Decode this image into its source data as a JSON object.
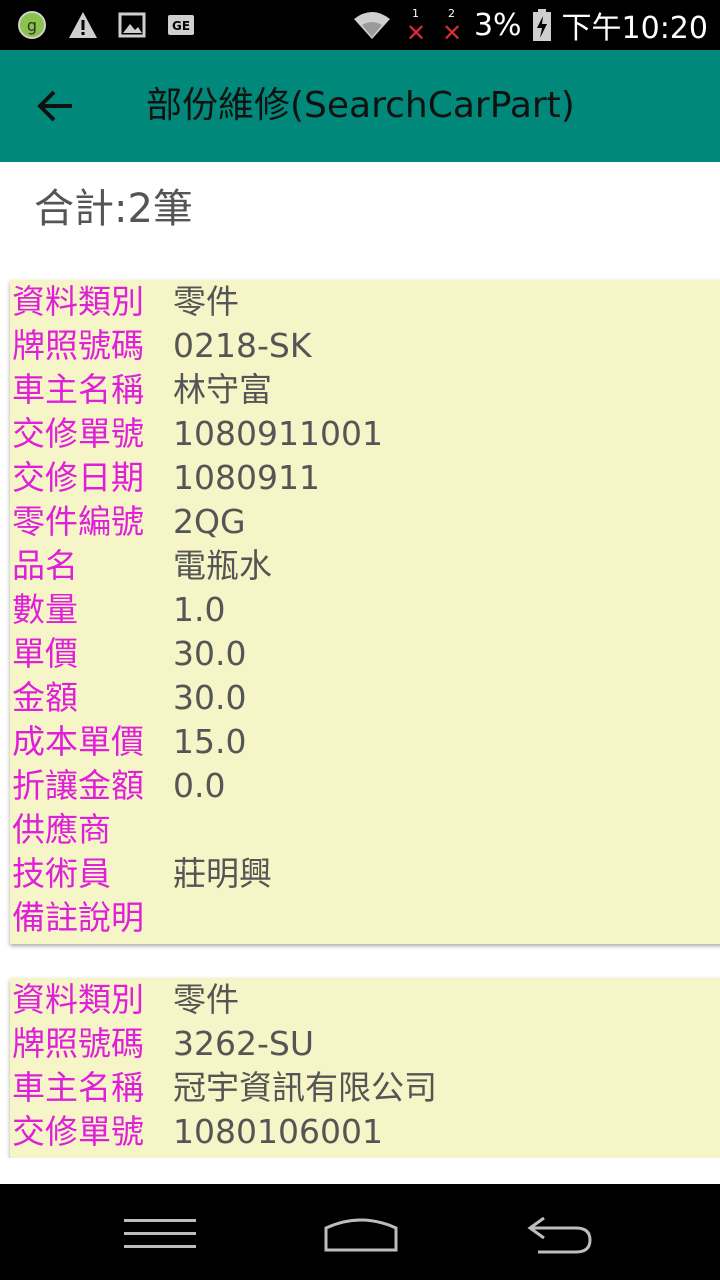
{
  "status_bar": {
    "battery": "3%",
    "time": "下午10:20",
    "sim1_label": "1",
    "sim2_label": "2",
    "icons": [
      "app-notification-icon",
      "warning-icon",
      "image-icon",
      "ge-icon",
      "wifi-icon",
      "battery-icon"
    ]
  },
  "app_bar": {
    "title": "部份維修(SearchCarPart)",
    "back_icon": "arrow-left-icon",
    "color": "#00897b"
  },
  "summary": {
    "total": "合計:2筆"
  },
  "colors": {
    "key": "#e020d8",
    "value": "#555555",
    "card": "#f5f5c8"
  },
  "records": [
    {
      "rows": [
        {
          "key": "資料類別",
          "value": "零件"
        },
        {
          "key": "牌照號碼",
          "value": "0218-SK"
        },
        {
          "key": "車主名稱",
          "value": "林守富"
        },
        {
          "key": "交修單號",
          "value": "1080911001"
        },
        {
          "key": "交修日期",
          "value": "1080911"
        },
        {
          "key": "零件編號",
          "value": "2QG"
        },
        {
          "key": "品名",
          "value": "電瓶水"
        },
        {
          "key": "數量",
          "value": "1.0"
        },
        {
          "key": "單價",
          "value": "30.0"
        },
        {
          "key": "金額",
          "value": "30.0"
        },
        {
          "key": "成本單價",
          "value": "15.0"
        },
        {
          "key": "折讓金額",
          "value": "0.0"
        },
        {
          "key": "供應商",
          "value": ""
        },
        {
          "key": "技術員",
          "value": "莊明興"
        },
        {
          "key": "備註說明",
          "value": ""
        }
      ]
    },
    {
      "rows": [
        {
          "key": "資料類別",
          "value": "零件"
        },
        {
          "key": "牌照號碼",
          "value": "3262-SU"
        },
        {
          "key": "車主名稱",
          "value": "冠宇資訊有限公司"
        },
        {
          "key": "交修單號",
          "value": "1080106001"
        }
      ]
    }
  ],
  "nav_bar": {
    "icons": [
      "menu-icon",
      "home-icon",
      "back-icon"
    ]
  }
}
